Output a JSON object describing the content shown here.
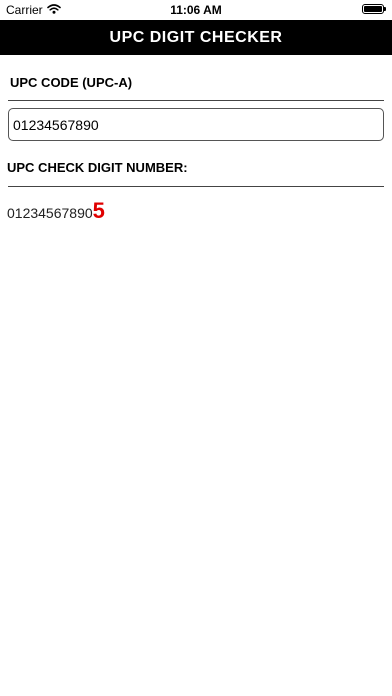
{
  "status_bar": {
    "carrier": "Carrier",
    "time": "11:06 AM",
    "battery_level": 1.0
  },
  "header": {
    "title": "UPC DIGIT CHECKER"
  },
  "form": {
    "upc_label": "UPC CODE (UPC-A)",
    "upc_value": "01234567890",
    "check_label": "UPC CHECK DIGIT NUMBER:"
  },
  "result": {
    "code": "01234567890",
    "check_digit": "5",
    "check_digit_color": "#e00000"
  },
  "icons": {
    "wifi": "wifi-icon",
    "battery": "battery-icon"
  }
}
